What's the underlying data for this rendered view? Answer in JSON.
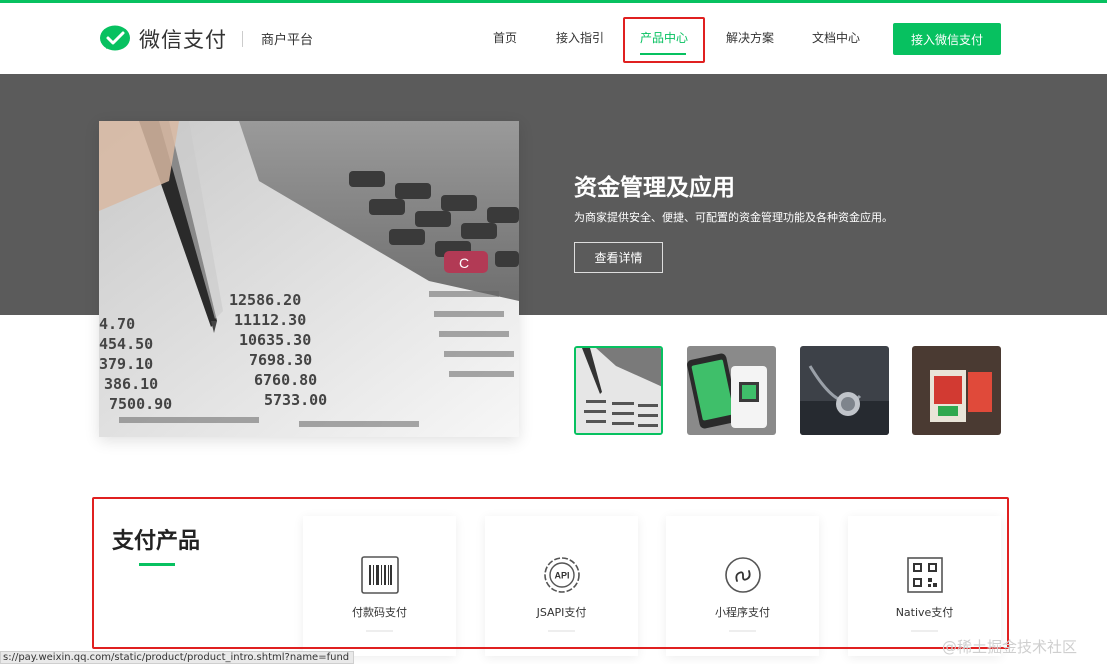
{
  "header": {
    "brand": "微信支付",
    "platform": "商户平台",
    "nav": [
      {
        "label": "首页"
      },
      {
        "label": "接入指引"
      },
      {
        "label": "产品中心"
      },
      {
        "label": "解决方案"
      },
      {
        "label": "文档中心"
      }
    ],
    "active_nav": "产品中心",
    "cta": "接入微信支付"
  },
  "hero": {
    "title": "资金管理及应用",
    "description": "为商家提供安全、便捷、可配置的资金管理功能及各种资金应用。",
    "button": "查看详情",
    "calc_numbers": [
      "12586.20",
      "11112.30",
      "10635.30",
      "7698.30",
      "6760.80",
      "5733.00",
      "4.70",
      "454.50",
      "379.10",
      "386.10",
      "7500.90"
    ],
    "calc_key": "C",
    "thumbnails": [
      {
        "icon": "calculator-photo-icon",
        "active": true
      },
      {
        "icon": "phone-pay-photo-icon",
        "active": false
      },
      {
        "icon": "stethoscope-photo-icon",
        "active": false
      },
      {
        "icon": "red-packet-photo-icon",
        "active": false
      }
    ]
  },
  "products": {
    "title": "支付产品",
    "cards": [
      {
        "label": "付款码支付",
        "icon": "barcode-icon"
      },
      {
        "label": "JSAPI支付",
        "icon": "api-gear-icon",
        "icon_text": "API"
      },
      {
        "label": "小程序支付",
        "icon": "mini-program-icon"
      },
      {
        "label": "Native支付",
        "icon": "qr-code-icon"
      }
    ]
  },
  "status_url": "s://pay.weixin.qq.com/static/product/product_intro.shtml?name=fund",
  "watermark": "@稀土掘金技术社区",
  "colors": {
    "brand_green": "#07c160",
    "highlight_red": "#e02020",
    "hero_bg": "#5b5b5b"
  }
}
